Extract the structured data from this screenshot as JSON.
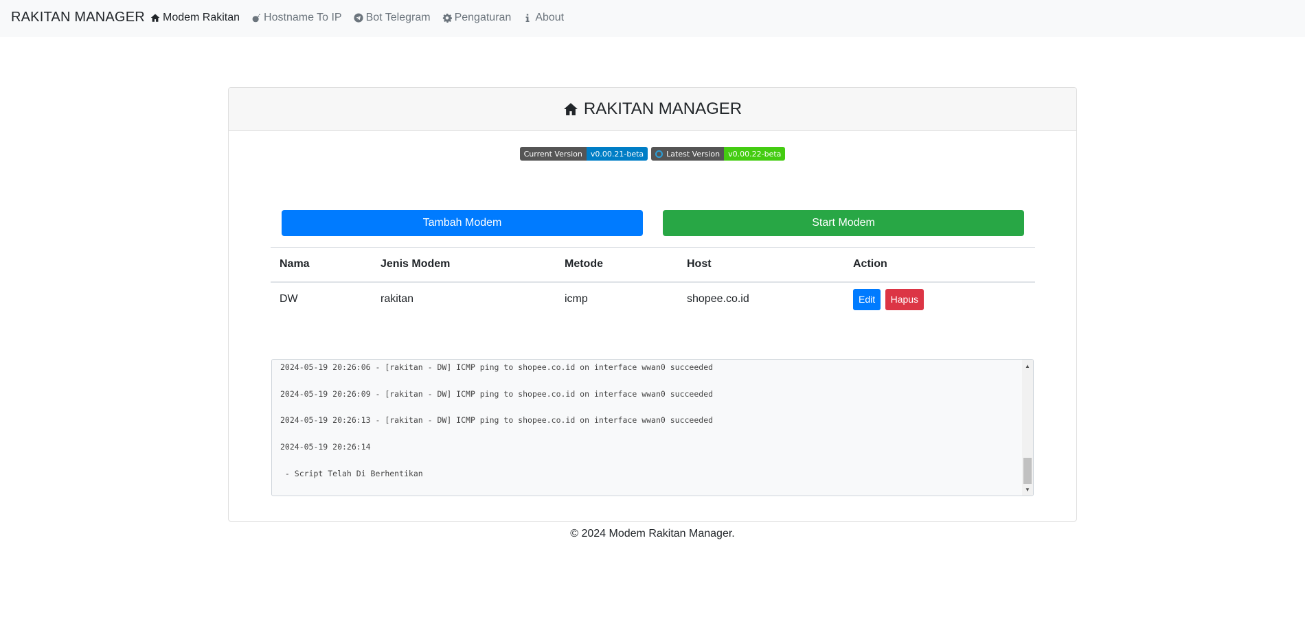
{
  "navbar": {
    "brand": "RAKITAN MANAGER",
    "links": [
      {
        "label": "Modem Rakitan",
        "icon": "home-icon",
        "active": true
      },
      {
        "label": "Hostname To IP",
        "icon": "bomb-icon",
        "active": false
      },
      {
        "label": "Bot Telegram",
        "icon": "telegram-icon",
        "active": false
      },
      {
        "label": "Pengaturan",
        "icon": "gear-icon",
        "active": false
      },
      {
        "label": "About",
        "icon": "info-icon",
        "active": false
      }
    ]
  },
  "card": {
    "title": "RAKITAN MANAGER",
    "title_icon": "home-icon",
    "badges": {
      "current_label": "Current Version",
      "current_value": "v0.00.21-beta",
      "latest_label": "Latest Version",
      "latest_value": "v0.00.22-beta"
    },
    "buttons": {
      "add_label": "Tambah Modem",
      "start_label": "Start Modem"
    },
    "table": {
      "headers": [
        "Nama",
        "Jenis Modem",
        "Metode",
        "Host",
        "Action"
      ],
      "rows": [
        {
          "nama": "DW",
          "jenis": "rakitan",
          "metode": "icmp",
          "host": "shopee.co.id",
          "edit_label": "Edit",
          "delete_label": "Hapus"
        }
      ]
    },
    "log": {
      "lines": [
        "2024-05-19 20:26:06 - [rakitan - DW] ICMP ping to shopee.co.id on interface wwan0 succeeded",
        "2024-05-19 20:26:09 - [rakitan - DW] ICMP ping to shopee.co.id on interface wwan0 succeeded",
        "2024-05-19 20:26:13 - [rakitan - DW] ICMP ping to shopee.co.id on interface wwan0 succeeded",
        "2024-05-19 20:26:14",
        " - Script Telah Di Berhentikan"
      ]
    }
  },
  "colors": {
    "primary": "#007bff",
    "success": "#28a745",
    "danger": "#dc3545",
    "badge_blue": "#007ec6",
    "badge_green": "#44cc11"
  },
  "footer": {
    "text": "© 2024 Modem Rakitan Manager."
  }
}
